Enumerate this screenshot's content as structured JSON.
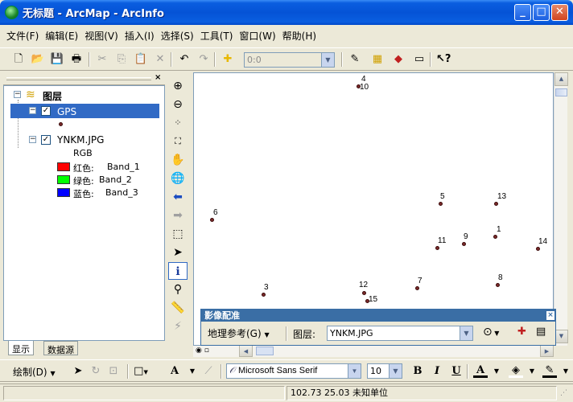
{
  "window": {
    "title": "无标题 - ArcMap - ArcInfo",
    "minimize": "_",
    "maximize": "□",
    "close": "✕"
  },
  "menu": [
    "文件(F)",
    "编辑(E)",
    "视图(V)",
    "插入(I)",
    "选择(S)",
    "工具(T)",
    "窗口(W)",
    "帮助(H)"
  ],
  "standard_toolbar": {
    "scale_value": "0:0"
  },
  "toc": {
    "root_label": "图层",
    "layers": [
      {
        "name": "GPS",
        "checked": true,
        "selected": true
      },
      {
        "name": "YNKM.JPG",
        "checked": true,
        "rgb_label": "RGB",
        "bands": [
          {
            "channel": "红色:",
            "band": "Band_1",
            "color": "#ff0000"
          },
          {
            "channel": "绿色:",
            "band": "Band_2",
            "color": "#00ff00"
          },
          {
            "channel": "蓝色:",
            "band": "Band_3",
            "color": "#0000ff"
          }
        ]
      }
    ],
    "tabs": [
      "显示",
      "数据源"
    ]
  },
  "map_points": [
    {
      "label": "4"
    },
    {
      "label": "10"
    },
    {
      "label": "6"
    },
    {
      "label": "5"
    },
    {
      "label": "13"
    },
    {
      "label": "1"
    },
    {
      "label": "9"
    },
    {
      "label": "11"
    },
    {
      "label": "14"
    },
    {
      "label": "3"
    },
    {
      "label": "12"
    },
    {
      "label": "15"
    },
    {
      "label": "7"
    },
    {
      "label": "8"
    }
  ],
  "georef": {
    "title": "影像配准",
    "menu_label": "地理参考(G)",
    "layer_label": "图层:",
    "layer_value": "YNKM.JPG"
  },
  "drawing": {
    "draw_label": "绘制(D)",
    "font_name": "Microsoft Sans Serif",
    "font_size": "10",
    "bold": "B",
    "italic": "I",
    "underline": "U"
  },
  "status": {
    "coords": "102.73  25.03 未知单位"
  }
}
